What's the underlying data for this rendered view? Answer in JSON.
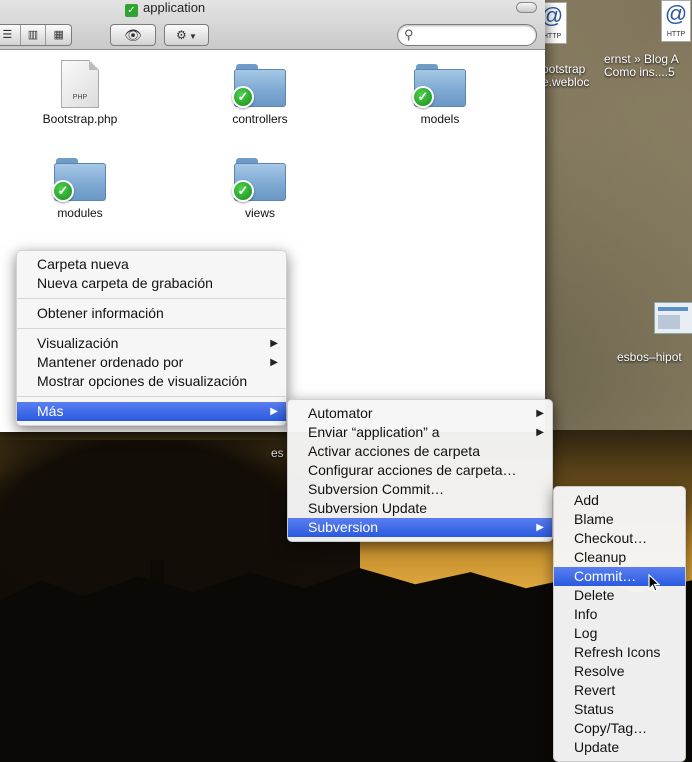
{
  "window": {
    "title": "application",
    "search_placeholder": ""
  },
  "toolbar": {
    "view_icons": [
      "☰",
      "▥",
      "▦"
    ],
    "quicklook_icon": "eye-icon",
    "action_icon": "gear-icon"
  },
  "files": [
    {
      "name": "Bootstrap.php",
      "type": "php",
      "ext": "PHP"
    },
    {
      "name": "controllers",
      "type": "folder"
    },
    {
      "name": "models",
      "type": "folder"
    },
    {
      "name": "modules",
      "type": "folder"
    },
    {
      "name": "views",
      "type": "folder"
    }
  ],
  "desktop": {
    "bootstrap_label": "ootstrap\ne.webloc",
    "blog_label": "ernst » Blog A\nComo ins....5",
    "esbos_label": "esbos–hipot",
    "es_label": "es",
    "http_icon_label": "HTTP",
    "http_glyph": "@"
  },
  "context_menu": {
    "group1": [
      "Carpeta nueva",
      "Nueva carpeta de grabación"
    ],
    "group2": [
      "Obtener información"
    ],
    "group3": [
      "Visualización",
      "Mantener ordenado por",
      "Mostrar opciones de visualización"
    ],
    "group4": [
      "Más"
    ]
  },
  "mas_menu": {
    "items": [
      "Automator",
      "Enviar “application” a",
      "Activar acciones de carpeta",
      "Configurar acciones de carpeta…",
      "Subversion Commit…",
      "Subversion Update",
      "Subversion"
    ]
  },
  "svn_menu": {
    "items": [
      "Add",
      "Blame",
      "Checkout…",
      "Cleanup",
      "Commit…",
      "Delete",
      "Info",
      "Log",
      "Refresh Icons",
      "Resolve",
      "Revert",
      "Status",
      "Copy/Tag…",
      "Update"
    ],
    "selected": "Commit…"
  },
  "colors": {
    "menu_highlight": "#2a5ae0",
    "badge_green": "#1f9e1f",
    "folder_blue": "#7eaad3"
  }
}
